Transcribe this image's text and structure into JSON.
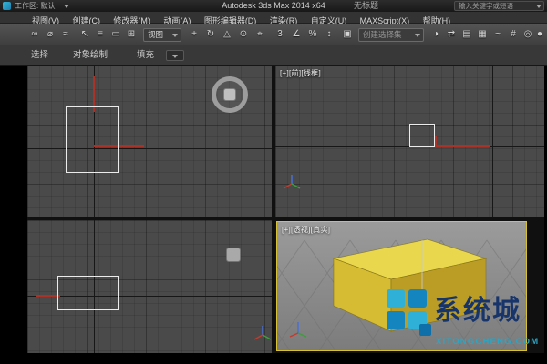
{
  "title_bar": {
    "workspace_label": "工作区: 默认",
    "app_title": "Autodesk 3ds Max 2014 x64",
    "doc_title": "无标题",
    "search_placeholder": "输入关键字或短语"
  },
  "menu_bar": {
    "items": [
      "视图(V)",
      "创建(C)",
      "修改器(M)",
      "动画(A)",
      "图形编辑器(D)",
      "渲染(R)",
      "自定义(U)",
      "MAXScript(X)",
      "帮助(H)"
    ]
  },
  "toolbar": {
    "coord_system": "视图",
    "named_sets": "创建选择集",
    "icons": [
      {
        "name": "select-and-link",
        "glyph": "∞"
      },
      {
        "name": "unlink-selection",
        "glyph": "⌀"
      },
      {
        "name": "bind-to-spacewarp",
        "glyph": "≈"
      },
      {
        "name": "select-object",
        "glyph": "↖"
      },
      {
        "name": "select-by-name",
        "glyph": "≡"
      },
      {
        "name": "selection-region",
        "glyph": "▭"
      },
      {
        "name": "window-crossing",
        "glyph": "⊞"
      },
      {
        "name": "select-and-move",
        "glyph": "+"
      },
      {
        "name": "select-and-rotate",
        "glyph": "↻"
      },
      {
        "name": "select-and-scale",
        "glyph": "△"
      },
      {
        "name": "use-pivot-center",
        "glyph": "⊙"
      },
      {
        "name": "select-and-manipulate",
        "glyph": "⌖"
      },
      {
        "name": "snaps-toggle",
        "glyph": "3"
      },
      {
        "name": "angle-snap",
        "glyph": "∠"
      },
      {
        "name": "percent-snap",
        "glyph": "%"
      },
      {
        "name": "spinner-snap",
        "glyph": "↕"
      },
      {
        "name": "edit-named-selection-sets",
        "glyph": "▣"
      },
      {
        "name": "mirror",
        "glyph": "◑"
      },
      {
        "name": "align",
        "glyph": "⇄"
      },
      {
        "name": "layer-manager",
        "glyph": "▤"
      },
      {
        "name": "graphite-ribbon",
        "glyph": "▦"
      },
      {
        "name": "curve-editor",
        "glyph": "~"
      },
      {
        "name": "schematic-view",
        "glyph": "#"
      },
      {
        "name": "material-editor",
        "glyph": "◎"
      },
      {
        "name": "render-setup",
        "glyph": "●"
      }
    ]
  },
  "ribbon_tabs": {
    "select": "选择",
    "object_paint": "对象绘制",
    "populate": "填充"
  },
  "viewports": {
    "front_label": "[+][前][线框]",
    "perspective_label": "[+][透视][真实]"
  },
  "watermark": {
    "brand": "系统城",
    "site": "XITONGCHENG.COM"
  },
  "colors": {
    "viewport_bg": "#4a4a4a",
    "persp_bg": "#8f8f8f",
    "box_top": "#e9d74e",
    "box_left": "#d6bc32",
    "box_right": "#bb9d26",
    "spline_red": "#aa3226",
    "shape_white": "#ececec",
    "active_viewport_border": "#d8c232",
    "brand_navy": "#17356b",
    "brand_teal": "#2fb0d6"
  }
}
